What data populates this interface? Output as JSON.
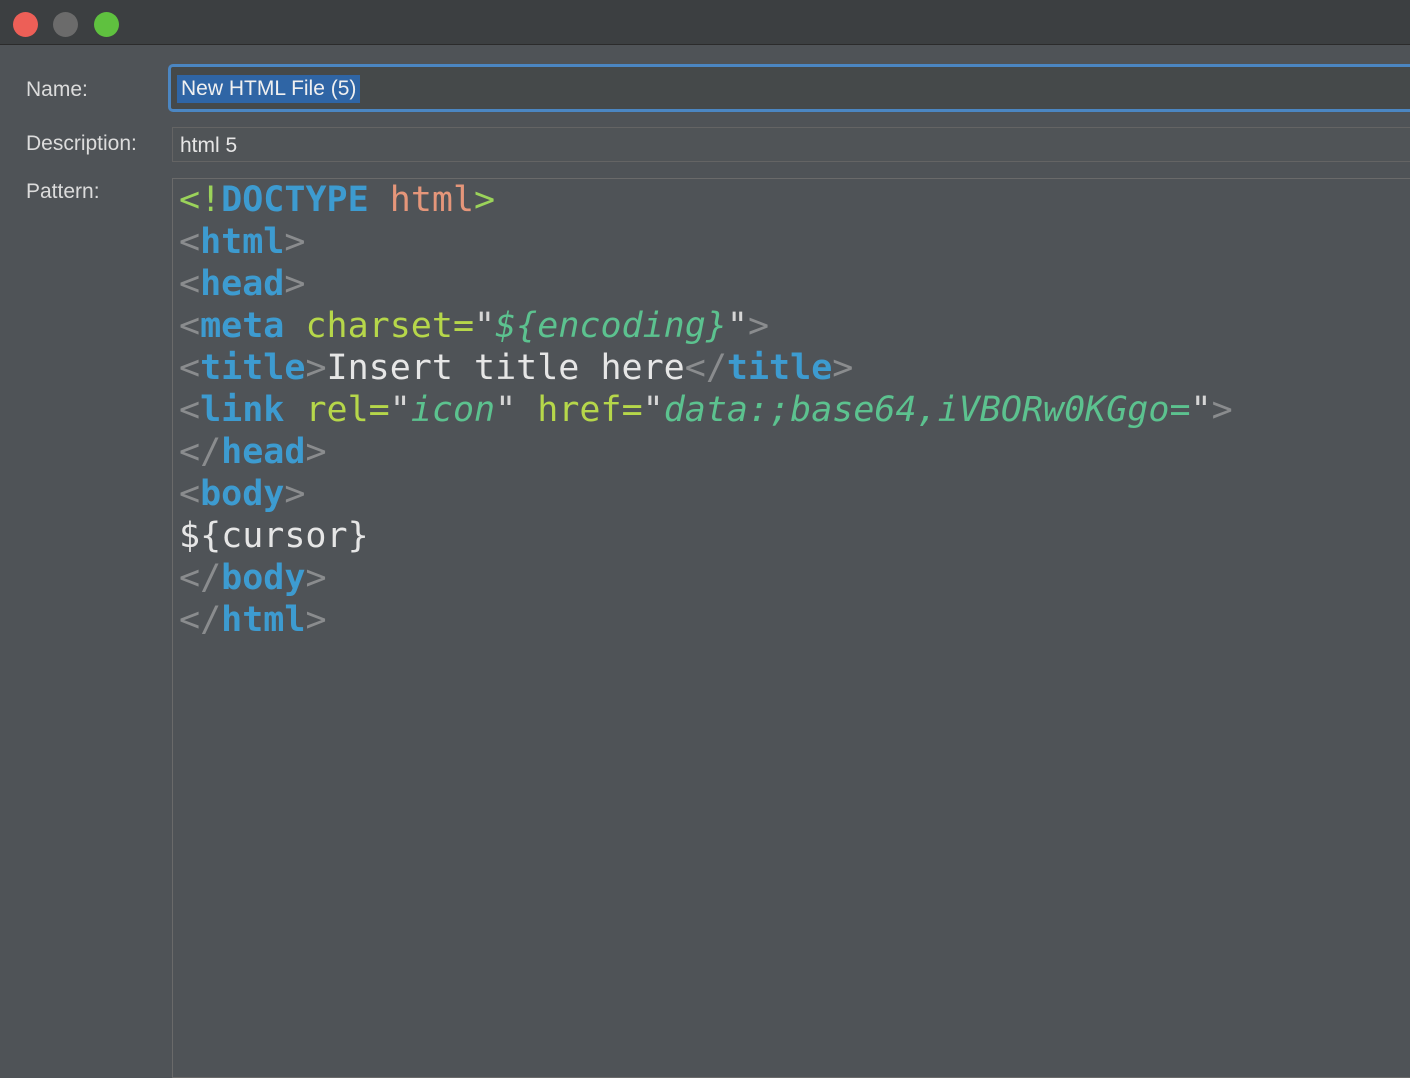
{
  "window": {
    "controls": [
      "close-icon",
      "minimize-icon",
      "zoom-icon"
    ]
  },
  "form": {
    "name_label": "Name:",
    "name_value": "New HTML File (5)",
    "description_label": "Description:",
    "description_value": "html 5",
    "pattern_label": "Pattern:"
  },
  "pattern": {
    "lines": [
      [
        {
          "t": "decl",
          "s": "<!"
        },
        {
          "t": "doc",
          "s": "DOCTYPE"
        },
        {
          "t": "text",
          "s": " "
        },
        {
          "t": "dtn",
          "s": "html"
        },
        {
          "t": "decl",
          "s": ">"
        }
      ],
      [
        {
          "t": "br",
          "s": "<"
        },
        {
          "t": "tag",
          "s": "html"
        },
        {
          "t": "br",
          "s": ">"
        }
      ],
      [
        {
          "t": "br",
          "s": "<"
        },
        {
          "t": "tag",
          "s": "head"
        },
        {
          "t": "br",
          "s": ">"
        }
      ],
      [
        {
          "t": "br",
          "s": "<"
        },
        {
          "t": "tag",
          "s": "meta"
        },
        {
          "t": "text",
          "s": " "
        },
        {
          "t": "attr",
          "s": "charset="
        },
        {
          "t": "q",
          "s": "\""
        },
        {
          "t": "val",
          "s": "${encoding}"
        },
        {
          "t": "q",
          "s": "\""
        },
        {
          "t": "br",
          "s": ">"
        }
      ],
      [
        {
          "t": "br",
          "s": "<"
        },
        {
          "t": "tag",
          "s": "title"
        },
        {
          "t": "br",
          "s": ">"
        },
        {
          "t": "text",
          "s": "Insert title here"
        },
        {
          "t": "br",
          "s": "</"
        },
        {
          "t": "tag",
          "s": "title"
        },
        {
          "t": "br",
          "s": ">"
        }
      ],
      [
        {
          "t": "br",
          "s": "<"
        },
        {
          "t": "tag",
          "s": "link"
        },
        {
          "t": "text",
          "s": " "
        },
        {
          "t": "attr",
          "s": "rel="
        },
        {
          "t": "q",
          "s": "\""
        },
        {
          "t": "val",
          "s": "icon"
        },
        {
          "t": "q",
          "s": "\""
        },
        {
          "t": "text",
          "s": " "
        },
        {
          "t": "attr",
          "s": "href="
        },
        {
          "t": "q",
          "s": "\""
        },
        {
          "t": "val",
          "s": "data:;base64,iVBORw0KGgo="
        },
        {
          "t": "q",
          "s": "\""
        },
        {
          "t": "br",
          "s": ">"
        }
      ],
      [
        {
          "t": "br",
          "s": "</"
        },
        {
          "t": "tag",
          "s": "head"
        },
        {
          "t": "br",
          "s": ">"
        }
      ],
      [
        {
          "t": "br",
          "s": "<"
        },
        {
          "t": "tag",
          "s": "body"
        },
        {
          "t": "br",
          "s": ">"
        }
      ],
      [
        {
          "t": "text",
          "s": "${cursor}"
        }
      ],
      [
        {
          "t": "br",
          "s": "</"
        },
        {
          "t": "tag",
          "s": "body"
        },
        {
          "t": "br",
          "s": ">"
        }
      ],
      [
        {
          "t": "br",
          "s": "</"
        },
        {
          "t": "tag",
          "s": "html"
        },
        {
          "t": "br",
          "s": ">"
        }
      ]
    ]
  },
  "colors": {
    "accent": "#4b86c2",
    "selection": "#2f65a5",
    "tag": "#3d9bd0",
    "attribute": "#b6d74a",
    "value": "#5cc28f",
    "doctype_name": "#e5967a",
    "bracket": "#8a8c8e"
  }
}
